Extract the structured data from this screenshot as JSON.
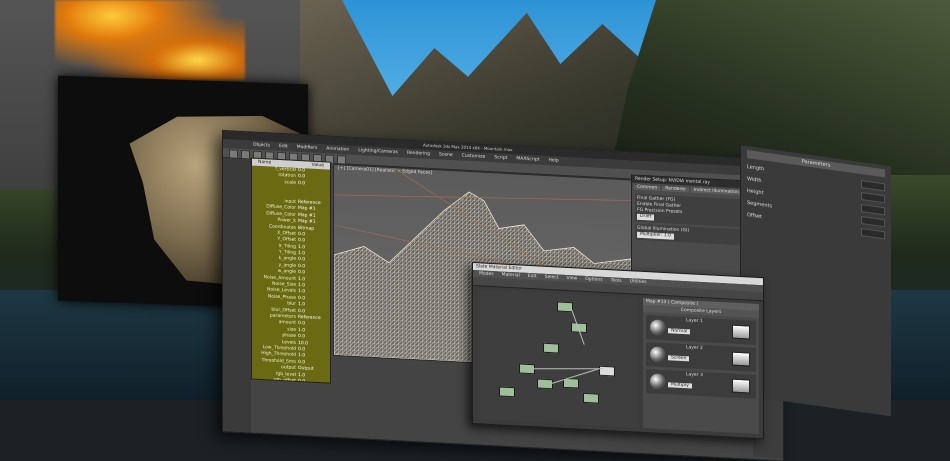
{
  "app": {
    "title": "Autodesk 3ds Max 2014 x64 - Mountain.max",
    "menu": [
      "Objects",
      "Edit",
      "Modifiers",
      "Animation",
      "Lighting/Cameras",
      "Rendering",
      "Scene",
      "Customize",
      "Script",
      "MAXScript",
      "Help"
    ]
  },
  "viewport": {
    "label": "[+] [Camera01] [Realistic + Edged Faces]"
  },
  "params": {
    "header_name": "Name",
    "header_value": "Value",
    "rows": [
      {
        "k": "f_vertical",
        "v": "0.0"
      },
      {
        "k": "rotation",
        "v": "0.0"
      },
      {
        "k": "scale",
        "v": "0.0"
      },
      {
        "k": "",
        "v": ""
      },
      {
        "k": "",
        "v": ""
      },
      {
        "k": "input",
        "v": "Reference"
      },
      {
        "k": "Diffuse_Color",
        "v": "Map #1"
      },
      {
        "k": "Diffuse_Color",
        "v": "Map #1"
      },
      {
        "k": "Power_k",
        "v": "Map #1"
      },
      {
        "k": "Coordinates",
        "v": "Bitmap"
      },
      {
        "k": "X_Offset",
        "v": "0.0"
      },
      {
        "k": "Y_Offset",
        "v": "0.0"
      },
      {
        "k": "X_Tiling",
        "v": "1.0"
      },
      {
        "k": "Y_Tiling",
        "v": "1.0"
      },
      {
        "k": "k_angle",
        "v": "0.0"
      },
      {
        "k": "y_angle",
        "v": "0.0"
      },
      {
        "k": "w_angle",
        "v": "0.0"
      },
      {
        "k": "Noise_Amount",
        "v": "1.0"
      },
      {
        "k": "Noise_Size",
        "v": "1.0"
      },
      {
        "k": "Noise_Levels",
        "v": "1.0"
      },
      {
        "k": "Noise_Phase",
        "v": "0.0"
      },
      {
        "k": "blur",
        "v": "1.0"
      },
      {
        "k": "blur_Offset",
        "v": "0.0"
      },
      {
        "k": "parameters",
        "v": "Reference"
      },
      {
        "k": "amount",
        "v": "0.0"
      },
      {
        "k": "size",
        "v": "1.0"
      },
      {
        "k": "phase",
        "v": "0.0"
      },
      {
        "k": "Levels",
        "v": "10.0"
      },
      {
        "k": "Low_Threshold",
        "v": "0.0"
      },
      {
        "k": "High_Threshold",
        "v": "1.0"
      },
      {
        "k": "Threshold_Smo",
        "v": "0.0"
      },
      {
        "k": "output",
        "v": "Output"
      },
      {
        "k": "rgb_level",
        "v": "1.0"
      },
      {
        "k": "rgb_offset",
        "v": "0.0"
      },
      {
        "k": "output_amount",
        "v": "1.0"
      }
    ]
  },
  "render": {
    "title": "Render Setup: NVIDIA mental ray",
    "tabs": [
      "Common",
      "Renderer",
      "Indirect Illumination",
      "Processing",
      "Render Elements"
    ],
    "sec1_title": "Final Gather (FG)",
    "sec1_line": "Enable Final Gather",
    "sec1_field": "Multiplier: 1.0",
    "sec2_title": "Global Illumination (GI)",
    "preset_label": "FG Precision Presets",
    "preset_value": "Draft"
  },
  "command": {
    "rows": [
      "Parameters",
      "Length",
      "Width",
      "Height",
      "Segments",
      "Offset"
    ],
    "head": "Parameters"
  },
  "slate": {
    "title": "Slate Material Editor",
    "menu": [
      "Modes",
      "Material",
      "Edit",
      "Select",
      "View",
      "Options",
      "Tools",
      "Utilities"
    ],
    "panel_title": "Map #13 ( Composite )",
    "section": "Composite Layers",
    "layers": [
      {
        "label": "Layer 1",
        "blend": "Normal"
      },
      {
        "label": "Layer 2",
        "blend": "Screen"
      },
      {
        "label": "Layer 3",
        "blend": "Multiply"
      }
    ]
  }
}
